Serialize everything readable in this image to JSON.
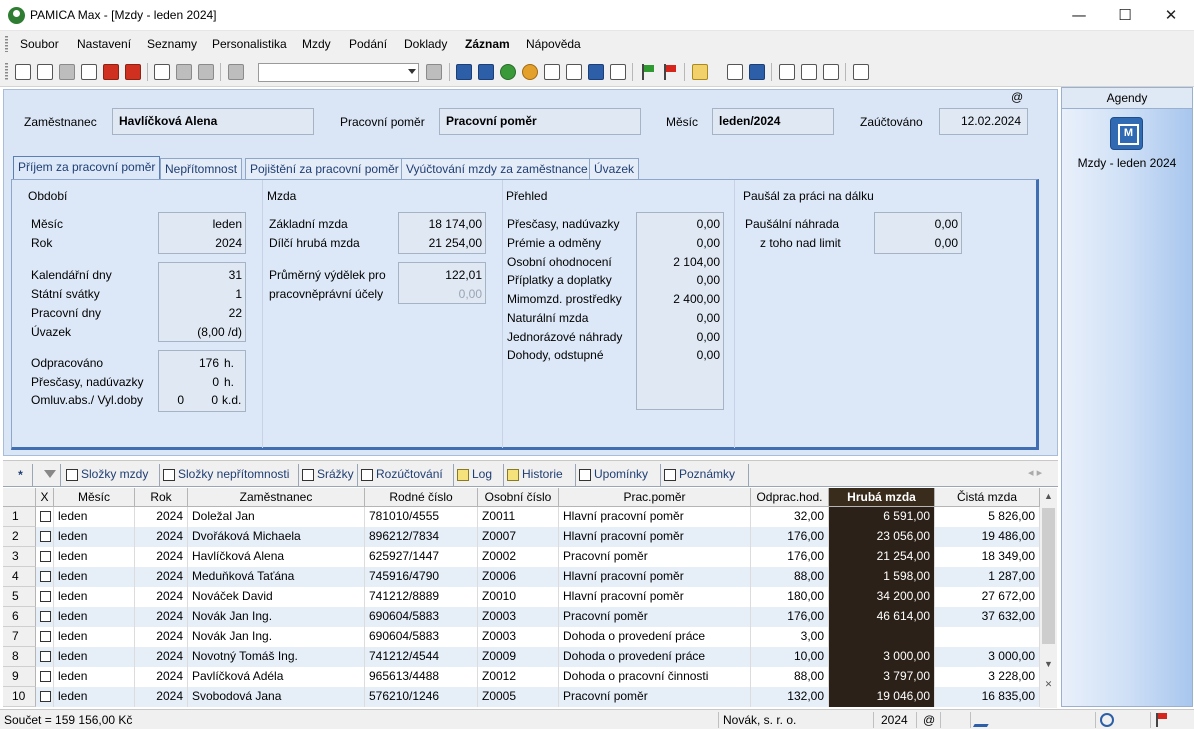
{
  "window": {
    "title": "PAMICA Max - [Mzdy - leden 2024]",
    "min": "—",
    "max": "☐",
    "close": "✕"
  },
  "menu": [
    "Soubor",
    "Nastavení",
    "Seznamy",
    "Personalistika",
    "Mzdy",
    "Podání",
    "Doklady",
    "Záznam",
    "Nápověda"
  ],
  "header": {
    "employee_label": "Zaměstnanec",
    "employee_value": "Havlíčková Alena",
    "employment_label": "Pracovní poměr",
    "employment_value": "Pracovní poměr",
    "month_label": "Měsíc",
    "month_value": "leden/2024",
    "posted_label": "Zaúčtováno",
    "posted_value": "12.02.2024",
    "at": "@"
  },
  "tabs": [
    "Příjem za pracovní poměr",
    "Nepřítomnost",
    "Pojištění za pracovní poměr",
    "Vyúčtování mzdy za zaměstnance",
    "Úvazek"
  ],
  "obdobi": {
    "title": "Období",
    "mesic_label": "Měsíc",
    "mesic_value": "leden",
    "rok_label": "Rok",
    "rok_value": "2024",
    "kal_label": "Kalendářní dny",
    "kal_value": "31",
    "svatky_label": "Státní svátky",
    "svatky_value": "1",
    "prac_label": "Pracovní dny",
    "prac_value": "22",
    "uvazek_label": "Úvazek",
    "uvazek_value": "(8,00 /d)",
    "odprac_label": "Odpracováno",
    "odprac_value": "176",
    "odprac_unit": "h.",
    "presc_label": "Přesčasy, nadúvazky",
    "presc_value": "0",
    "presc_unit": "h.",
    "omluv_label": "Omluv.abs./ Vyl.doby",
    "omluv_value1": "0",
    "omluv_value2": "0",
    "omluv_unit": "k.d."
  },
  "mzda": {
    "title": "Mzda",
    "zakladni_label": "Základní mzda",
    "zakladni_value": "18 174,00",
    "dilci_label": "Dílčí hrubá mzda",
    "dilci_value": "21 254,00",
    "prumer_label1": "Průměrný výdělek pro",
    "prumer_label2": "pracovněprávní účely",
    "prumer_value1": "122,01",
    "prumer_value2": "0,00"
  },
  "prehled": {
    "title": "Přehled",
    "rows": [
      {
        "label": "Přesčasy, nadúvazky",
        "value": "0,00"
      },
      {
        "label": "Prémie a odměny",
        "value": "0,00"
      },
      {
        "label": "Osobní ohodnocení",
        "value": "2 104,00"
      },
      {
        "label": "Příplatky a doplatky",
        "value": "0,00"
      },
      {
        "label": "Mimomzd. prostředky",
        "value": "2 400,00"
      },
      {
        "label": "Naturální mzda",
        "value": "0,00"
      },
      {
        "label": "Jednorázové náhrady",
        "value": "0,00"
      },
      {
        "label": "Dohody, odstupné",
        "value": "0,00"
      }
    ]
  },
  "pausal": {
    "title": "Paušál za práci na dálku",
    "nahrada_label": "Paušální náhrada",
    "nahrada_value": "0,00",
    "limit_label": "z toho nad limit",
    "limit_value": "0,00"
  },
  "agendy": {
    "header": "Agendy",
    "item": "Mzdy - leden 2024"
  },
  "subtabs": {
    "star": "*",
    "items": [
      "Složky mzdy",
      "Složky nepřítomnosti",
      "Srážky",
      "Rozúčtování",
      "Log",
      "Historie",
      "Upomínky",
      "Poznámky"
    ],
    "nav": "◂ ▸"
  },
  "grid": {
    "headers": [
      "",
      "X",
      "Měsíc",
      "Rok",
      "Zaměstnanec",
      "Rodné číslo",
      "Osobní číslo",
      "Prac.poměr",
      "Odprac.hod.",
      "Hrubá mzda",
      "Čistá mzda"
    ],
    "rows": [
      [
        "1",
        "leden",
        "2024",
        "Doležal Jan",
        "781010/4555",
        "Z0011",
        "Hlavní pracovní poměr",
        "32,00",
        "6 591,00",
        "5 826,00"
      ],
      [
        "2",
        "leden",
        "2024",
        "Dvořáková Michaela",
        "896212/7834",
        "Z0007",
        "Hlavní pracovní poměr",
        "176,00",
        "23 056,00",
        "19 486,00"
      ],
      [
        "3",
        "leden",
        "2024",
        "Havlíčková Alena",
        "625927/1447",
        "Z0002",
        "Pracovní poměr",
        "176,00",
        "21 254,00",
        "18 349,00"
      ],
      [
        "4",
        "leden",
        "2024",
        "Meduňková Taťána",
        "745916/4790",
        "Z0006",
        "Hlavní pracovní poměr",
        "88,00",
        "1 598,00",
        "1 287,00"
      ],
      [
        "5",
        "leden",
        "2024",
        "Nováček David",
        "741212/8889",
        "Z0010",
        "Hlavní pracovní poměr",
        "180,00",
        "34 200,00",
        "27 672,00"
      ],
      [
        "6",
        "leden",
        "2024",
        "Novák Jan Ing.",
        "690604/5883",
        "Z0003",
        "Pracovní poměr",
        "176,00",
        "46 614,00",
        "37 632,00"
      ],
      [
        "7",
        "leden",
        "2024",
        "Novák Jan Ing.",
        "690604/5883",
        "Z0003",
        "Dohoda o provedení práce",
        "3,00",
        "",
        ""
      ],
      [
        "8",
        "leden",
        "2024",
        "Novotný Tomáš Ing.",
        "741212/4544",
        "Z0009",
        "Dohoda o provedení práce",
        "10,00",
        "3 000,00",
        "3 000,00"
      ],
      [
        "9",
        "leden",
        "2024",
        "Pavlíčková Adéla",
        "965613/4488",
        "Z0012",
        "Dohoda o pracovní činnosti",
        "88,00",
        "3 797,00",
        "3 228,00"
      ],
      [
        "10",
        "leden",
        "2024",
        "Svobodová Jana",
        "576210/1246",
        "Z0005",
        "Pracovní poměr",
        "132,00",
        "19 046,00",
        "16 835,00"
      ]
    ]
  },
  "status": {
    "sum": "Součet = 159 156,00 Kč",
    "company": "Novák, s. r. o.",
    "year": "2024",
    "at": "@"
  },
  "colors": {
    "highlight_column": "#2b2118",
    "panel_bg": "#dae6f6",
    "tab_accent": "#3f6fb2"
  }
}
